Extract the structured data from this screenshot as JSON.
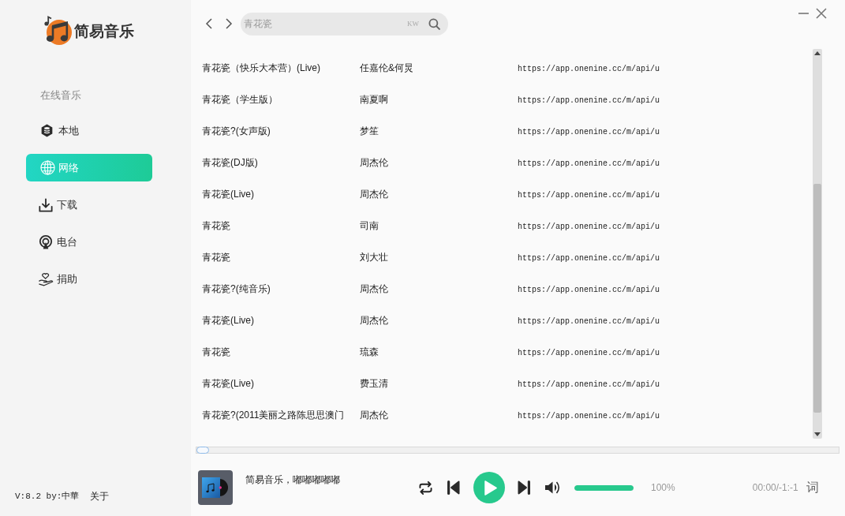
{
  "app": {
    "name": "简易音乐"
  },
  "sidebar": {
    "section_label": "在线音乐",
    "items": [
      {
        "label": "本地",
        "kind": "local",
        "selected": false
      },
      {
        "label": "网络",
        "kind": "network",
        "selected": true
      },
      {
        "label": "下载",
        "kind": "download",
        "selected": false
      },
      {
        "label": "电台",
        "kind": "radio",
        "selected": false
      },
      {
        "label": "捐助",
        "kind": "donate",
        "selected": false
      }
    ],
    "footer": {
      "version": "V:8.2 by:中華",
      "about_link": "关于"
    }
  },
  "search": {
    "value": "青花瓷",
    "source": "KW"
  },
  "results": {
    "rows": [
      {
        "title": "青花瓷（快乐大本营）(Live)",
        "artist": "任嘉伦&何炅",
        "url": "https://app.onenine.cc/m/api/u"
      },
      {
        "title": "青花瓷（学生版）",
        "artist": "南夏啊",
        "url": "https://app.onenine.cc/m/api/u"
      },
      {
        "title": "青花瓷?(女声版)",
        "artist": "梦笙",
        "url": "https://app.onenine.cc/m/api/u"
      },
      {
        "title": "青花瓷(DJ版)",
        "artist": "周杰伦",
        "url": "https://app.onenine.cc/m/api/u"
      },
      {
        "title": "青花瓷(Live)",
        "artist": "周杰伦",
        "url": "https://app.onenine.cc/m/api/u"
      },
      {
        "title": "青花瓷",
        "artist": "司南",
        "url": "https://app.onenine.cc/m/api/u"
      },
      {
        "title": "青花瓷",
        "artist": "刘大壮",
        "url": "https://app.onenine.cc/m/api/u"
      },
      {
        "title": "青花瓷?(纯音乐)",
        "artist": "周杰伦",
        "url": "https://app.onenine.cc/m/api/u"
      },
      {
        "title": "青花瓷(Live)",
        "artist": "周杰伦",
        "url": "https://app.onenine.cc/m/api/u"
      },
      {
        "title": "青花瓷",
        "artist": "琉森",
        "url": "https://app.onenine.cc/m/api/u"
      },
      {
        "title": "青花瓷(Live)",
        "artist": "费玉清",
        "url": "https://app.onenine.cc/m/api/u"
      },
      {
        "title": "青花瓷?(2011美丽之路陈思思澳门",
        "artist": "周杰伦",
        "url": "https://app.onenine.cc/m/api/u"
      }
    ]
  },
  "player": {
    "title": "简易音乐，嘟嘟嘟嘟嘟",
    "playing": false,
    "progress": {
      "level": 0
    },
    "volume": {
      "level": 1,
      "reading": "100%"
    },
    "time": "00:00/-1:-1",
    "lyrics_button": "词"
  }
}
